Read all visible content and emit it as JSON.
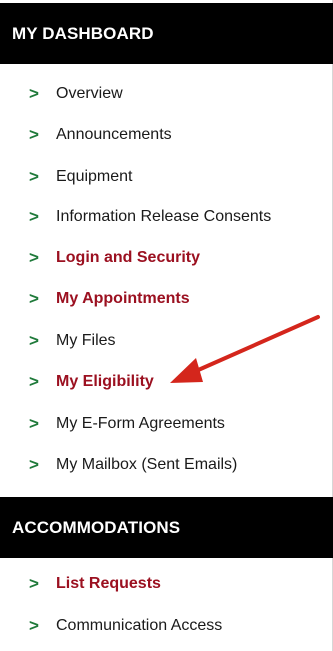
{
  "dashboard": {
    "title": "MY DASHBOARD",
    "items": [
      {
        "label": "Overview",
        "bold": false
      },
      {
        "label": "Announcements",
        "bold": false
      },
      {
        "label": "Equipment",
        "bold": false
      },
      {
        "label": "Information Release Consents",
        "bold": false
      },
      {
        "label": "Login and Security",
        "bold": true
      },
      {
        "label": "My Appointments",
        "bold": true
      },
      {
        "label": "My Files",
        "bold": false
      },
      {
        "label": "My Eligibility",
        "bold": true
      },
      {
        "label": "My E-Form Agreements",
        "bold": false
      },
      {
        "label": "My Mailbox (Sent Emails)",
        "bold": false
      }
    ]
  },
  "accommodations": {
    "title": "ACCOMMODATIONS",
    "items": [
      {
        "label": "List Requests",
        "bold": true
      },
      {
        "label": "Communication Access",
        "bold": false
      }
    ]
  },
  "chevron_glyph": ">",
  "colors": {
    "header_bg": "#000000",
    "highlight": "#9b1020",
    "chevron": "#1f7a3a",
    "arrow": "#d4261c"
  },
  "annotation": {
    "icon": "arrow-pointer-icon",
    "points_to": "My Eligibility"
  }
}
